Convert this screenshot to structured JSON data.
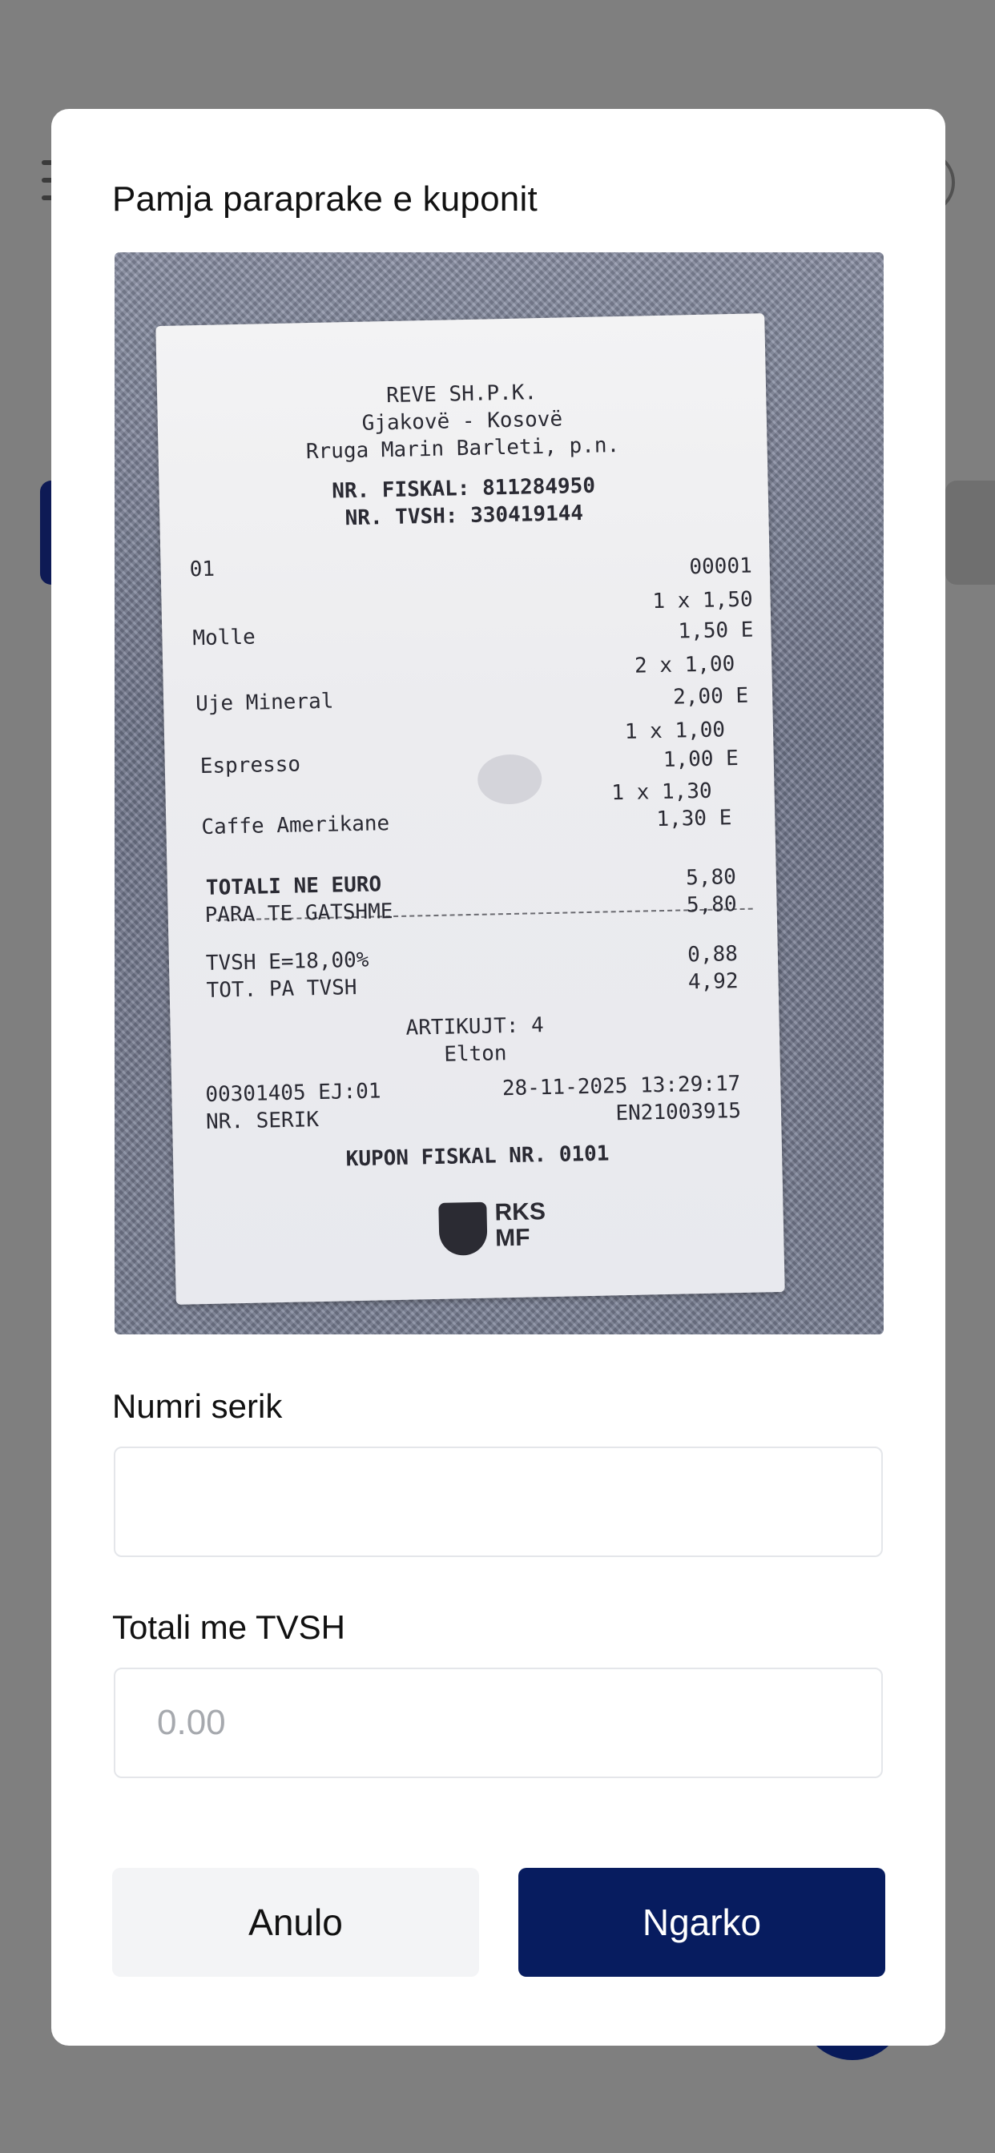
{
  "modal": {
    "title": "Pamja paraprake e kuponit",
    "fields": {
      "serial": {
        "label": "Numri serik",
        "value": "",
        "placeholder": ""
      },
      "total": {
        "label": "Totali me TVSH",
        "value": "",
        "placeholder": "0.00"
      }
    },
    "buttons": {
      "cancel": "Anulo",
      "upload": "Ngarko"
    },
    "colors": {
      "primary": "#071c5f",
      "overlay": "#7f7f7f",
      "cancel_bg": "#f3f4f6"
    }
  },
  "receipt": {
    "header": [
      "REVE SH.P.K.",
      "Gjakovë - Kosovë",
      "Rruga Marin Barleti, p.n."
    ],
    "fiscal_no": "NR. FISKAL: 811284950",
    "vat_no": "NR. TVSH: 330419144",
    "code_left": "01",
    "code_right": "00001",
    "items": [
      {
        "qty_price": "1 x 1,50",
        "name": "Molle",
        "amount": "1,50 E"
      },
      {
        "qty_price": "2 x 1,00",
        "name": "Uje Mineral",
        "amount": "2,00 E"
      },
      {
        "qty_price": "1 x 1,00",
        "name": "Espresso",
        "amount": "1,00 E"
      },
      {
        "qty_price": "1 x 1,30",
        "name": "Caffe Amerikane",
        "amount": "1,30 E"
      }
    ],
    "total_label": "TOTALI NE EURO",
    "total_value": "5,80",
    "cash_label": "PARA TE GATSHME",
    "cash_value": "5,80",
    "vat_label": "TVSH E=18,00%",
    "vat_value": "0,88",
    "net_label": "TOT. PA TVSH",
    "net_value": "4,92",
    "articles": "ARTIKUJT: 4",
    "cashier": "Elton",
    "ej_code": "00301405 EJ:01",
    "datetime": "28-11-2025 13:29:17",
    "serial_label": "NR. SERIK",
    "serial_value": "EN21003915",
    "coupon": "KUPON FISKAL NR. 0101",
    "logo_text_top": "RKS",
    "logo_text_bottom": "MF"
  }
}
